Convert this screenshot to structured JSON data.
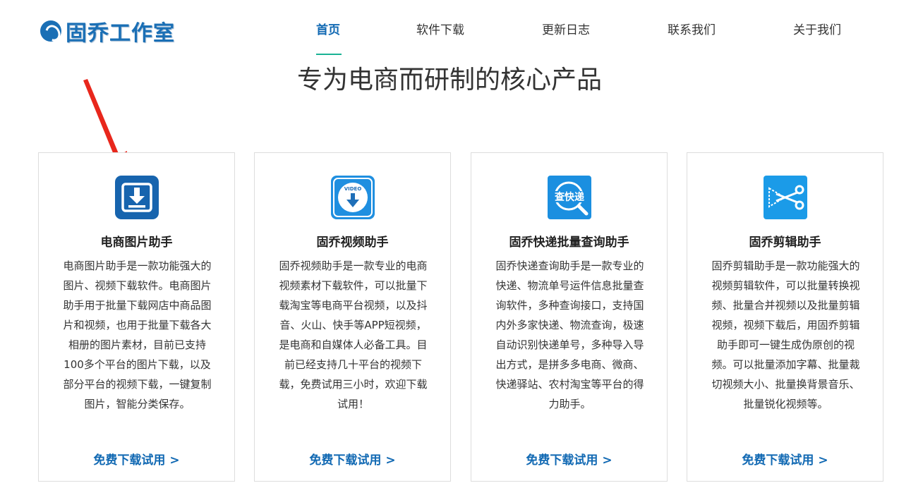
{
  "brand": {
    "name": "固乔工作室",
    "color": "#1a6fb5"
  },
  "nav": [
    {
      "label": "首页",
      "active": true
    },
    {
      "label": "软件下载",
      "active": false
    },
    {
      "label": "更新日志",
      "active": false
    },
    {
      "label": "联系我们",
      "active": false
    },
    {
      "label": "关于我们",
      "active": false
    }
  ],
  "headline": "专为电商而研制的核心产品",
  "colors": {
    "accent": "#1169b3",
    "underline": "#1ab394",
    "annotation_arrow": "#e8271c"
  },
  "products": [
    {
      "icon": "download-icon",
      "title": "电商图片助手",
      "description": "电商图片助手是一款功能强大的图片、视频下载软件。电商图片助手用于批量下载网店中商品图片和视频，也用于批量下载各大相册的图片素材，目前已支持100多个平台的图片下载，以及部分平台的视频下载，一键复制图片，智能分类保存。",
      "cta": "免费下载试用 >"
    },
    {
      "icon": "video-download-icon",
      "icon_text": "VIDEO",
      "title": "固乔视频助手",
      "description": "固乔视频助手是一款专业的电商视频素材下载软件，可以批量下载淘宝等电商平台视频，以及抖音、火山、快手等APP短视频，是电商和自媒体人必备工具。目前已经支持几十平台的视频下载，免费试用三小时，欢迎下载试用！",
      "cta": "免费下载试用 >"
    },
    {
      "icon": "express-search-icon",
      "icon_text": "查快递",
      "title": "固乔快递批量查询助手",
      "description": "固乔快递查询助手是一款专业的快递、物流单号运件信息批量查询软件，多种查询接口，支持国内外多家快递、物流查询，极速自动识别快递单号，多种导入导出方式，是拼多多电商、微商、快递驿站、农村淘宝等平台的得力助手。",
      "cta": "免费下载试用 >"
    },
    {
      "icon": "scissors-icon",
      "title": "固乔剪辑助手",
      "description": "固乔剪辑助手是一款功能强大的视频剪辑软件，可以批量转换视频、批量合并视频以及批量剪辑视频，视频下载后，用固乔剪辑助手即可一键生成伪原创的视频。可以批量添加字幕、批量裁切视频大小、批量换背景音乐、批量锐化视频等。",
      "cta": "免费下载试用 >"
    }
  ]
}
